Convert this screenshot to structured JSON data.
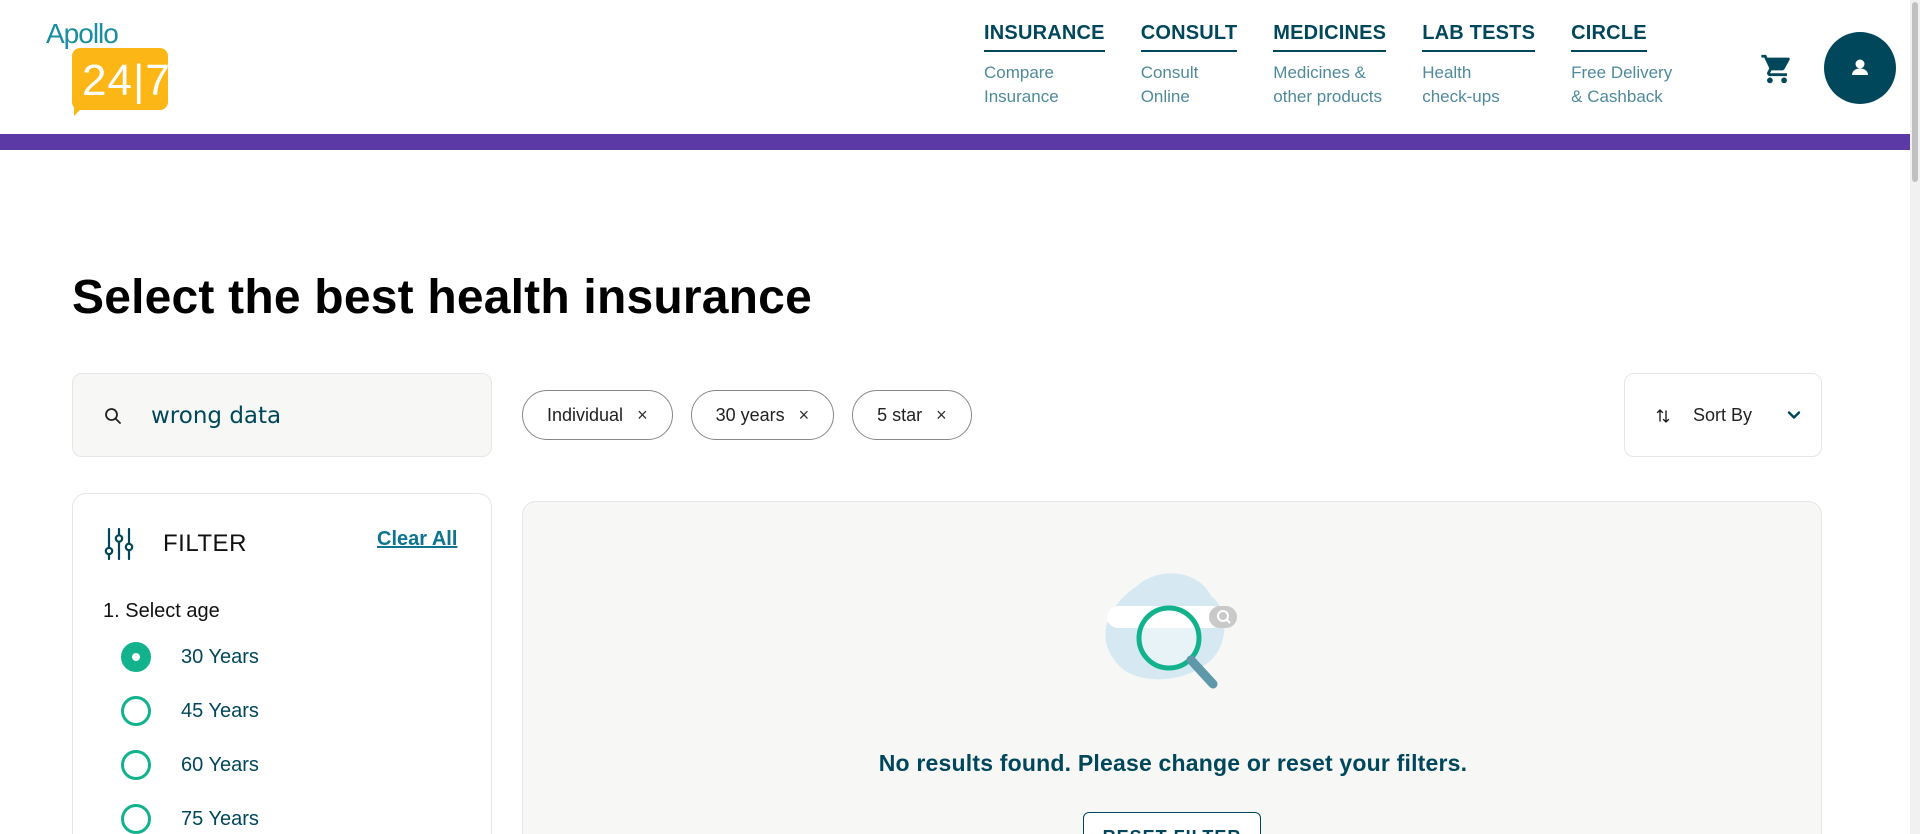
{
  "brand": {
    "name": "Apollo",
    "number": "24|7"
  },
  "nav": [
    {
      "title": "INSURANCE",
      "sub": "Compare\nInsurance"
    },
    {
      "title": "CONSULT",
      "sub": "Consult\nOnline"
    },
    {
      "title": "MEDICINES",
      "sub": "Medicines &\nother products"
    },
    {
      "title": "LAB TESTS",
      "sub": "Health\ncheck-ups"
    },
    {
      "title": "CIRCLE",
      "sub": "Free Delivery\n& Cashback"
    }
  ],
  "icons": {
    "cart": "shopping-cart-icon",
    "profile": "person-icon",
    "search": "search-icon",
    "filter": "sliders-icon",
    "sort": "sort-arrows-icon",
    "chevron": "chevron-down-icon"
  },
  "colors": {
    "primary": "#01475b",
    "accent_green": "#12b28c",
    "purple_bar": "#5b3aa6",
    "logo_yellow": "#fcb716"
  },
  "page": {
    "title": "Select the best health insurance"
  },
  "search": {
    "value": "wrong data"
  },
  "chips": [
    {
      "label": "Individual",
      "close": "×"
    },
    {
      "label": "30 years",
      "close": "×"
    },
    {
      "label": "5 star",
      "close": "×"
    }
  ],
  "sort": {
    "label": "Sort By"
  },
  "filter": {
    "title": "FILTER",
    "clear_label": "Clear All",
    "section_label": "1. Select age",
    "options": [
      {
        "label": "30 Years",
        "checked": true
      },
      {
        "label": "45 Years",
        "checked": false
      },
      {
        "label": "60 Years",
        "checked": false
      },
      {
        "label": "75 Years",
        "checked": false
      }
    ]
  },
  "results": {
    "empty_message": "No results found. Please change or reset your filters.",
    "reset_label": "RESET FILTER"
  }
}
